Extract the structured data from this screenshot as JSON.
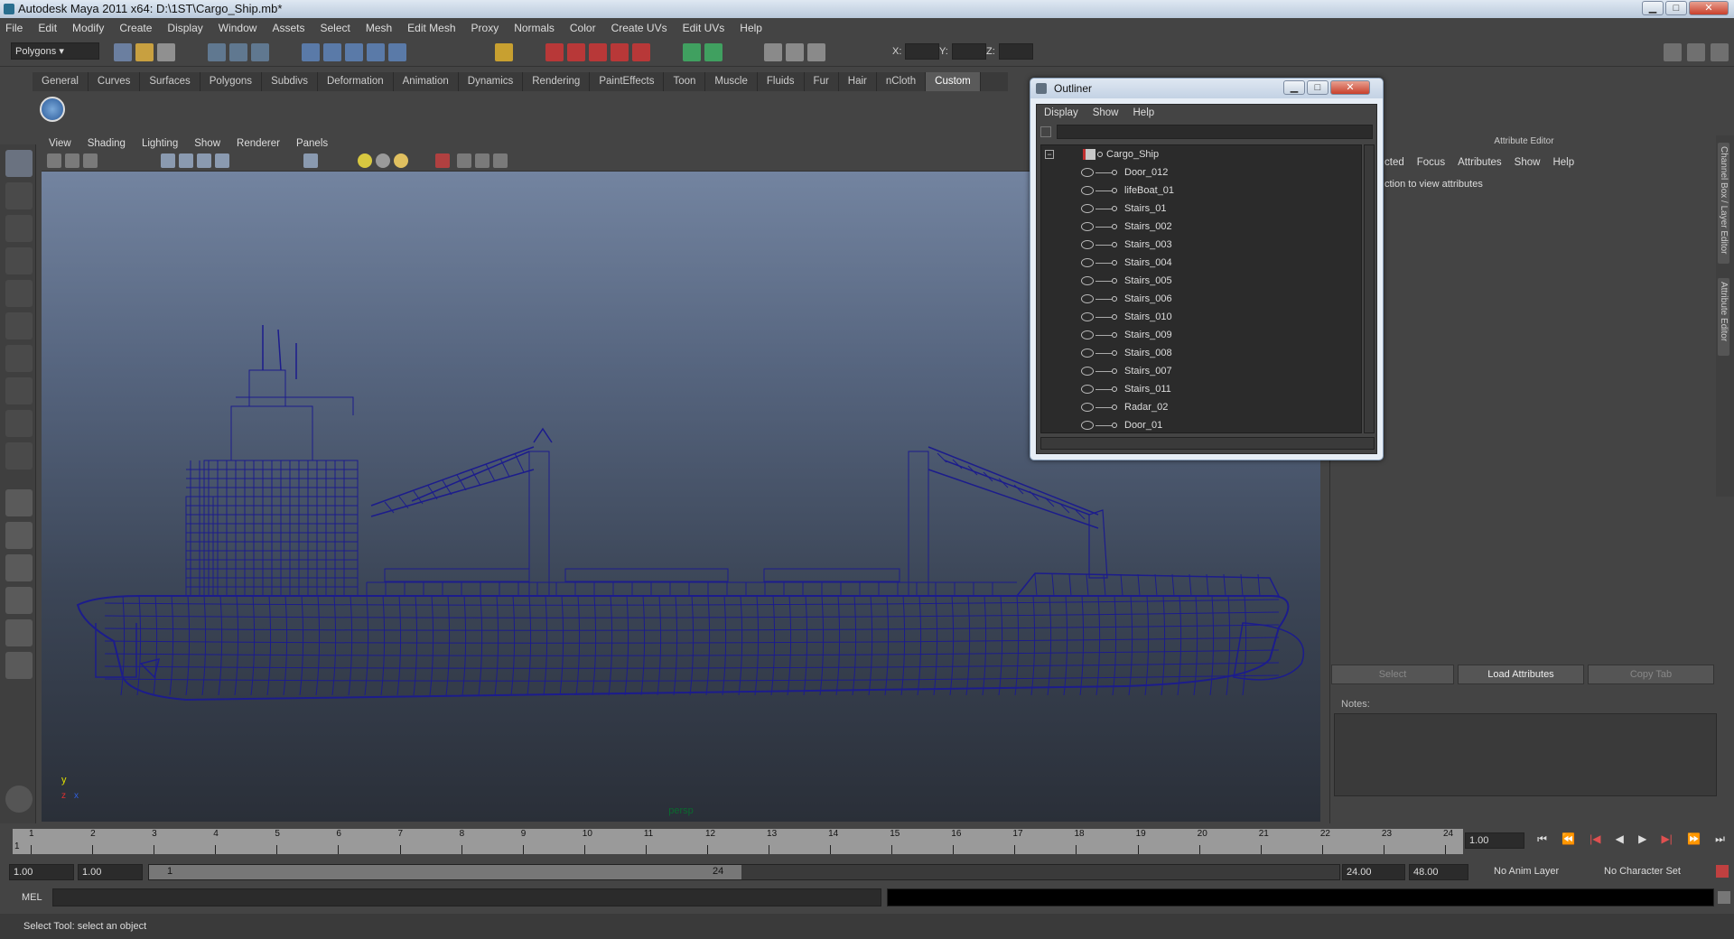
{
  "window": {
    "title": "Autodesk Maya 2011 x64: D:\\1ST\\Cargo_Ship.mb*"
  },
  "menubar": [
    "File",
    "Edit",
    "Modify",
    "Create",
    "Display",
    "Window",
    "Assets",
    "Select",
    "Mesh",
    "Edit Mesh",
    "Proxy",
    "Normals",
    "Color",
    "Create UVs",
    "Edit UVs",
    "Help"
  ],
  "statusline": {
    "mode": "Polygons",
    "x_label": "X:",
    "y_label": "Y:",
    "z_label": "Z:"
  },
  "shelf": {
    "tabs": [
      "General",
      "Curves",
      "Surfaces",
      "Polygons",
      "Subdivs",
      "Deformation",
      "Animation",
      "Dynamics",
      "Rendering",
      "PaintEffects",
      "Toon",
      "Muscle",
      "Fluids",
      "Fur",
      "Hair",
      "nCloth",
      "Custom"
    ],
    "active_tab": "Custom"
  },
  "viewport": {
    "menu": [
      "View",
      "Shading",
      "Lighting",
      "Show",
      "Renderer",
      "Panels"
    ],
    "camera": "persp",
    "axis_y": "y",
    "axis_x": "x",
    "axis_z": "z",
    "wire_color": "#1c1c8c"
  },
  "outliner": {
    "title": "Outliner",
    "menu": [
      "Display",
      "Show",
      "Help"
    ],
    "root": "Cargo_Ship",
    "items": [
      "Door_012",
      "lifeBoat_01",
      "Stairs_01",
      "Stairs_002",
      "Stairs_003",
      "Stairs_004",
      "Stairs_005",
      "Stairs_006",
      "Stairs_010",
      "Stairs_009",
      "Stairs_008",
      "Stairs_007",
      "Stairs_011",
      "Radar_02",
      "Door_01"
    ]
  },
  "attribute_editor": {
    "title": "Attribute Editor",
    "menu": [
      "cted",
      "Focus",
      "Attributes",
      "Show",
      "Help"
    ],
    "hint": "ction to view attributes",
    "notes_label": "Notes:",
    "buttons": {
      "select": "Select",
      "load": "Load Attributes",
      "copy": "Copy Tab"
    }
  },
  "side_tabs": [
    "Channel Box / Layer Editor",
    "Attribute Editor"
  ],
  "timeline": {
    "frames": [
      "1",
      "2",
      "3",
      "4",
      "5",
      "6",
      "7",
      "8",
      "9",
      "10",
      "11",
      "12",
      "13",
      "14",
      "15",
      "16",
      "17",
      "18",
      "19",
      "20",
      "21",
      "22",
      "23",
      "24"
    ],
    "current_frame_left": "1",
    "current_frame": "1.00"
  },
  "range": {
    "start": "1.00",
    "start2": "1.00",
    "slider_start": "1",
    "slider_end": "24",
    "end": "24.00",
    "end2": "48.00",
    "anim_layer": "No Anim Layer",
    "char_set": "No Character Set"
  },
  "command_line": {
    "label": "MEL"
  },
  "help_line": "Select Tool: select an object"
}
